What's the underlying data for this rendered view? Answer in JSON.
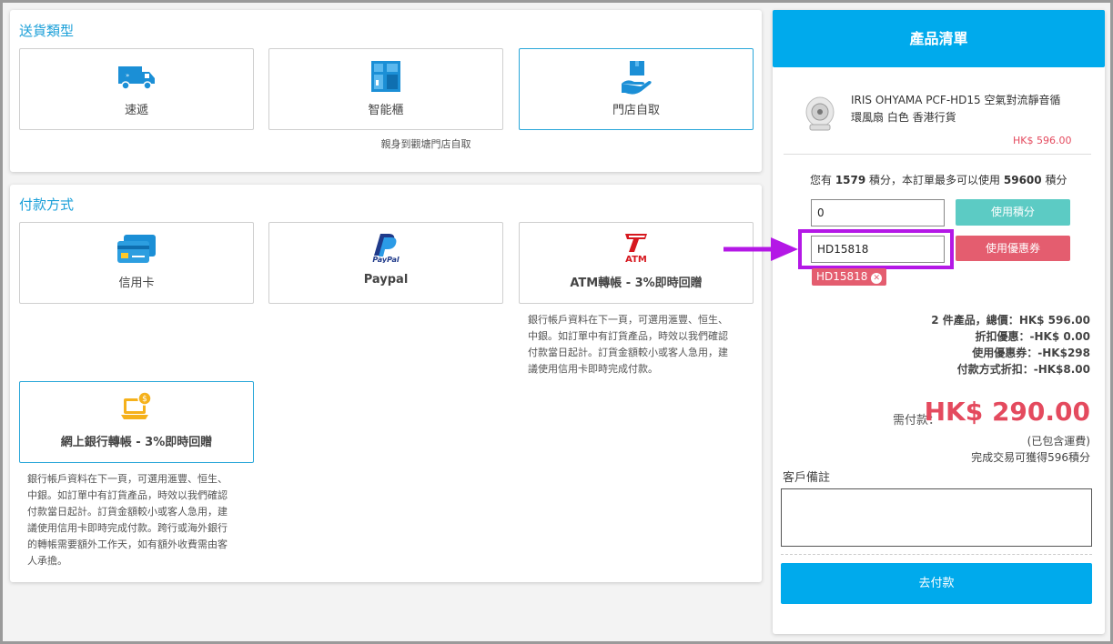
{
  "delivery": {
    "title": "送貨類型",
    "options": [
      {
        "label": "速遞",
        "icon": "delivery-truck-icon"
      },
      {
        "label": "智能櫃",
        "icon": "smart-locker-icon"
      },
      {
        "label": "門店自取",
        "icon": "store-pickup-icon"
      }
    ],
    "selected": "門店自取",
    "note": "親身到觀塘門店自取"
  },
  "payment": {
    "title": "付款方式",
    "options": [
      {
        "label": "信用卡",
        "icon": "credit-card-icon"
      },
      {
        "label": "Paypal",
        "icon": "paypal-logo-icon",
        "logo_text": "PayPal"
      },
      {
        "label": "ATM轉帳 - 3%即時回贈",
        "icon": "atm-icon",
        "logo_text": "ATM"
      },
      {
        "label": "網上銀行轉帳 - 3%即時回贈",
        "icon": "online-banking-icon"
      }
    ],
    "selected": "網上銀行轉帳 - 3%即時回贈",
    "atm_note": [
      "銀行帳戶資料在下一頁，可選用滙豐、恒生、",
      "中銀。如訂單中有訂貨產品，時效以我們確認",
      "付款當日起計。訂貨金額較小或客人急用，建",
      "議使用信用卡即時完成付款。"
    ],
    "bank_note": [
      "銀行帳戶資料在下一頁，可選用滙豐、恒生、",
      "中銀。如訂單中有訂貨產品，時效以我們確認",
      "付款當日起計。訂貨金額較小或客人急用，建",
      "議使用信用卡即時完成付款。跨行或海外銀行",
      "的轉帳需要額外工作天，如有額外收費需由客",
      "人承擔。"
    ]
  },
  "cart": {
    "title": "產品清單",
    "product": {
      "name_line1": "IRIS OHYAMA PCF-HD15 空氣對流靜音循",
      "name_line2": "環風扇 白色 香港行貨",
      "price": "HK$ 596.00"
    },
    "points": {
      "prefix": "您有 ",
      "have": "1579",
      "middle": " 積分，本訂單最多可以使用 ",
      "max": "59600",
      "suffix": " 積分"
    },
    "points_input": "0",
    "points_button": "使用積分",
    "coupon_input": "HD15818",
    "coupon_button": "使用優惠券",
    "coupon_tag": "HD15818",
    "summary": {
      "items_prefix": "2 件產品，總價：",
      "items_total": "HK$ 596.00",
      "discount": "折扣優惠：-HK$ 0.00",
      "coupon": "使用優惠券：-HK$298",
      "payment_discount": "付款方式折扣：-HK$8.00"
    },
    "due_label": "需付款：",
    "due_amount": "HK$ 290.00",
    "shipping_note": "(已包含運費)",
    "earn_note": "完成交易可獲得596積分",
    "remarks_label": "客戶備註",
    "remarks_value": "",
    "pay_button": "去付款"
  },
  "colors": {
    "accent": "#00aaec",
    "title_blue": "#1a9fd8",
    "points_btn": "#5ccbc4",
    "coupon_btn": "#e45d6f",
    "price_red": "#e44a5e",
    "annotation": "#b418e6"
  }
}
